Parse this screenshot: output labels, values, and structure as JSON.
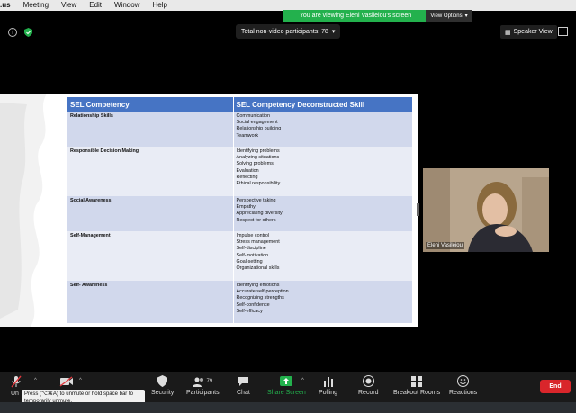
{
  "menubar": {
    "app": ".us",
    "items": [
      "Meeting",
      "View",
      "Edit",
      "Window",
      "Help"
    ]
  },
  "banner": {
    "text": "You are viewing Eleni Vasileiou's screen",
    "view_options": "View Options"
  },
  "top": {
    "participants_label": "Total non-video participants: 78",
    "speaker_view": "Speaker View"
  },
  "table": {
    "headers": [
      "SEL Competency",
      "SEL Competency Deconstructed Skill"
    ],
    "rows": [
      {
        "competency": "Relationship Skills",
        "skills": [
          "Communication",
          "Social engagement",
          "Relationship building",
          "Teamwork"
        ]
      },
      {
        "competency": "Responsible Decision Making",
        "skills": [
          "Identifying problems",
          "Analyzing situations",
          "Solving problems",
          "Evaluation",
          "Reflecting",
          "Ethical responsibility"
        ]
      },
      {
        "competency": "Social Awareness",
        "skills": [
          "Perspective taking",
          "Empathy",
          "Appreciating diversity",
          "Respect for others"
        ]
      },
      {
        "competency": "Self-Management",
        "skills": [
          "Impulse control",
          "Stress management",
          "Self-discipline",
          "Self-motivation",
          "Goal-setting",
          "Organizational skills"
        ]
      },
      {
        "competency": "Self- Awareness",
        "skills": [
          "Identifying emotions",
          "Accurate self-perception",
          "Recognizing strengths",
          "Self-confidence",
          "Self-efficacy"
        ]
      }
    ]
  },
  "video": {
    "name": "Eleni Vasileiou"
  },
  "toolbar": {
    "unmute": "Un",
    "security": "Security",
    "participants": "Participants",
    "participants_count": "79",
    "chat": "Chat",
    "share_screen": "Share Screen",
    "polling": "Polling",
    "record": "Record",
    "breakout_rooms": "Breakout Rooms",
    "reactions": "Reactions",
    "end": "End"
  },
  "tooltip": "Press (⌥⌘A) to unmute or hold space bar to temporarily unmute.",
  "colors": {
    "banner_green": "#23b14d",
    "table_header": "#4674c4",
    "end_red": "#d9262b"
  }
}
